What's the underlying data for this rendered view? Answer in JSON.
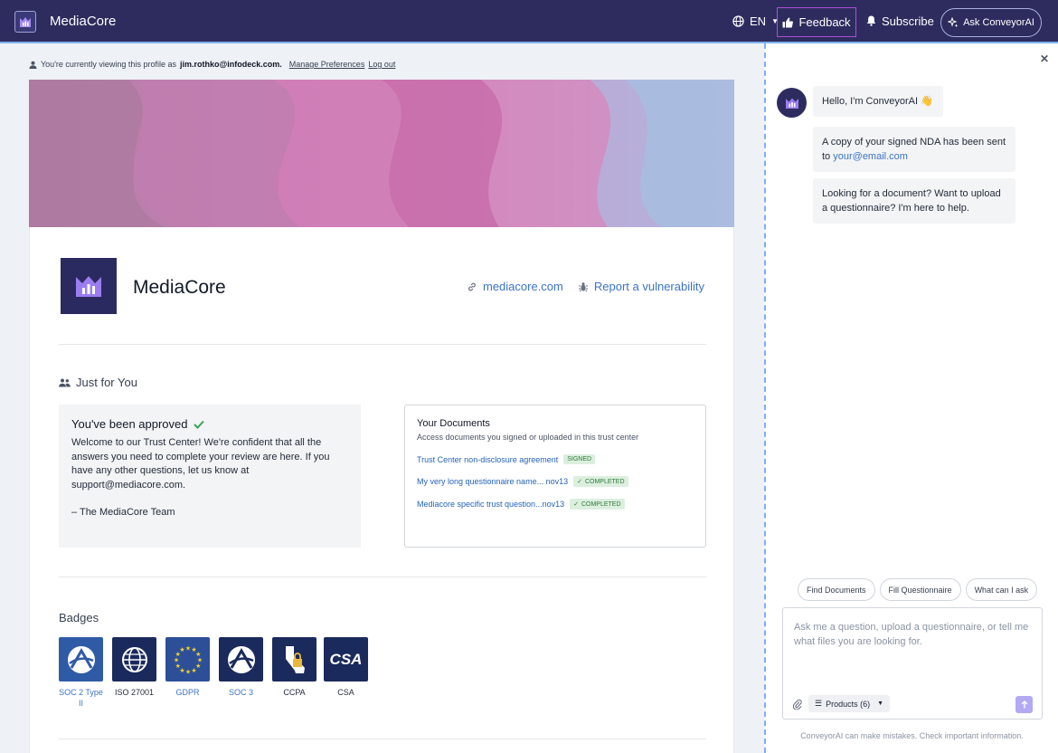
{
  "header": {
    "brand": "MediaCore",
    "language": "EN",
    "feedback": "Feedback",
    "subscribe": "Subscribe",
    "ask": "Ask ConveyorAI"
  },
  "viewing": {
    "prefix": "You're currently viewing this profile as",
    "email": "jim.rothko@infodeck.com.",
    "manage": "Manage Preferences",
    "logout": "Log out"
  },
  "company": {
    "name": "MediaCore",
    "website": "mediacore.com",
    "report": "Report a vulnerability"
  },
  "just_for_you": {
    "title": "Just for You",
    "approved_title": "You've been approved",
    "approved_body": "Welcome to our Trust Center! We're confident that all the answers you need to complete your review are here. If you have any other questions, let us know at support@mediacore.com.",
    "signoff": "– The MediaCore Team"
  },
  "documents": {
    "title": "Your Documents",
    "subtitle": "Access documents you signed or uploaded in this trust center",
    "items": [
      {
        "name": "Trust Center non-disclosure agreement",
        "status": "SIGNED"
      },
      {
        "name": "My very long questionnaire name... nov13",
        "status": "COMPLETED"
      },
      {
        "name": "Mediacore specific trust question...nov13",
        "status": "COMPLETED"
      }
    ]
  },
  "badges": {
    "title": "Badges",
    "items": [
      {
        "label": "SOC 2 Type II"
      },
      {
        "label": "ISO 27001"
      },
      {
        "label": "GDPR"
      },
      {
        "label": "SOC 3"
      },
      {
        "label": "CCPA"
      },
      {
        "label": "CSA",
        "logo_text": "CSA"
      }
    ]
  },
  "chat": {
    "greeting": "Hello, I'm ConveyorAI 👋",
    "nda_text": "A copy of your signed NDA has been sent to",
    "nda_email": "your@email.com",
    "help": "Looking for a document? Want to upload a questionnaire? I'm here to help.",
    "chips": [
      "Find Documents",
      "Fill Questionnaire",
      "What can I ask"
    ],
    "placeholder": "Ask me a question, upload a questionnaire, or tell me what files you are looking for.",
    "products": "Products (6)",
    "disclaimer": "ConveyorAI can make mistakes. Check important information."
  }
}
